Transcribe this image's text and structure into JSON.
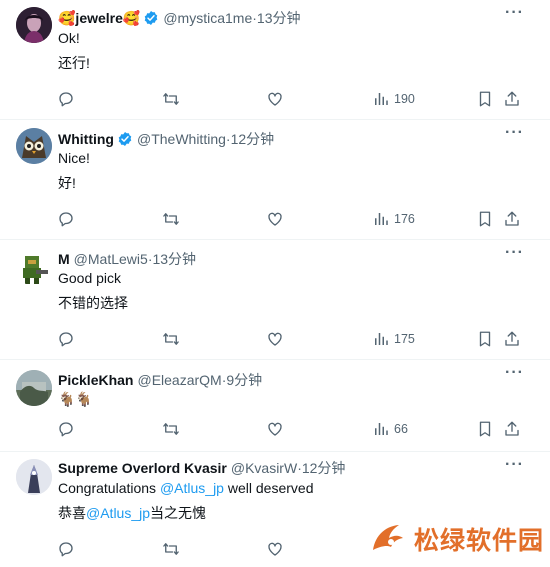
{
  "tweets": [
    {
      "name": "🥰jewelre🥰",
      "verified": true,
      "handle": "@mystica1me",
      "time": "13分钟",
      "text": "Ok!",
      "translation": "还行!",
      "views": "190"
    },
    {
      "name": "Whitting",
      "verified": true,
      "handle": "@TheWhitting",
      "time": "12分钟",
      "text": "Nice!",
      "translation": "好!",
      "views": "176"
    },
    {
      "name": "M",
      "verified": false,
      "handle": "@MatLewi5",
      "time": "13分钟",
      "text": "Good pick",
      "translation": "不错的选择",
      "views": "175"
    },
    {
      "name": "PickleKhan",
      "verified": false,
      "handle": "@EleazarQM",
      "time": "9分钟",
      "text": "🐐🐐",
      "translation": "",
      "views": "66"
    },
    {
      "name": "Supreme Overlord Kvasir",
      "verified": false,
      "handle": "@KvasirW",
      "time": "12分钟",
      "text_parts": [
        "Congratulations ",
        "@Atlus_jp",
        " well deserved"
      ],
      "translation_parts": [
        "恭喜",
        "@Atlus_jp",
        "当之无愧"
      ],
      "views": ""
    }
  ],
  "separator": " · ",
  "more": "···",
  "watermark": {
    "text": "松绿软件园",
    "color": "#e26f2a"
  },
  "colors": {
    "accent": "#1d9bf0",
    "secondary": "#536471"
  }
}
